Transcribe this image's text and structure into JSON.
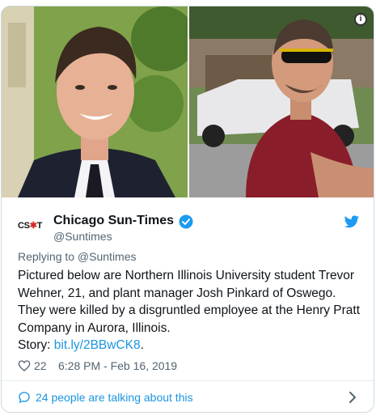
{
  "account": {
    "name": "Chicago Sun-Times",
    "handle": "@Suntimes",
    "logo_text_left": "CS",
    "logo_star": "✱",
    "logo_text_right": "T"
  },
  "tweet": {
    "replying_to": "Replying to @Suntimes",
    "text": "Pictured below are Northern Illinois University student Trevor Wehner, 21, and plant manager Josh Pinkard of Oswego. They were killed by a disgruntled employee at the Henry Pratt Company in Aurora, Illinois.",
    "story_label": "Story: ",
    "story_link": "bit.ly/2BBwCK8",
    "story_suffix": ".",
    "likes": "22",
    "timestamp": "6:28 PM - Feb 16, 2019"
  },
  "footer": {
    "talking_label": "24 people are talking about this"
  },
  "icons": {
    "info": "info-icon",
    "verified": "verified-badge-icon",
    "twitter": "twitter-bird-icon",
    "like": "heart-icon",
    "reply": "speech-bubble-icon",
    "chevron": "chevron-right-icon"
  },
  "colors": {
    "link": "#1b95e0",
    "muted": "#536471",
    "text": "#0f1419",
    "verified": "#1d9bf0"
  }
}
